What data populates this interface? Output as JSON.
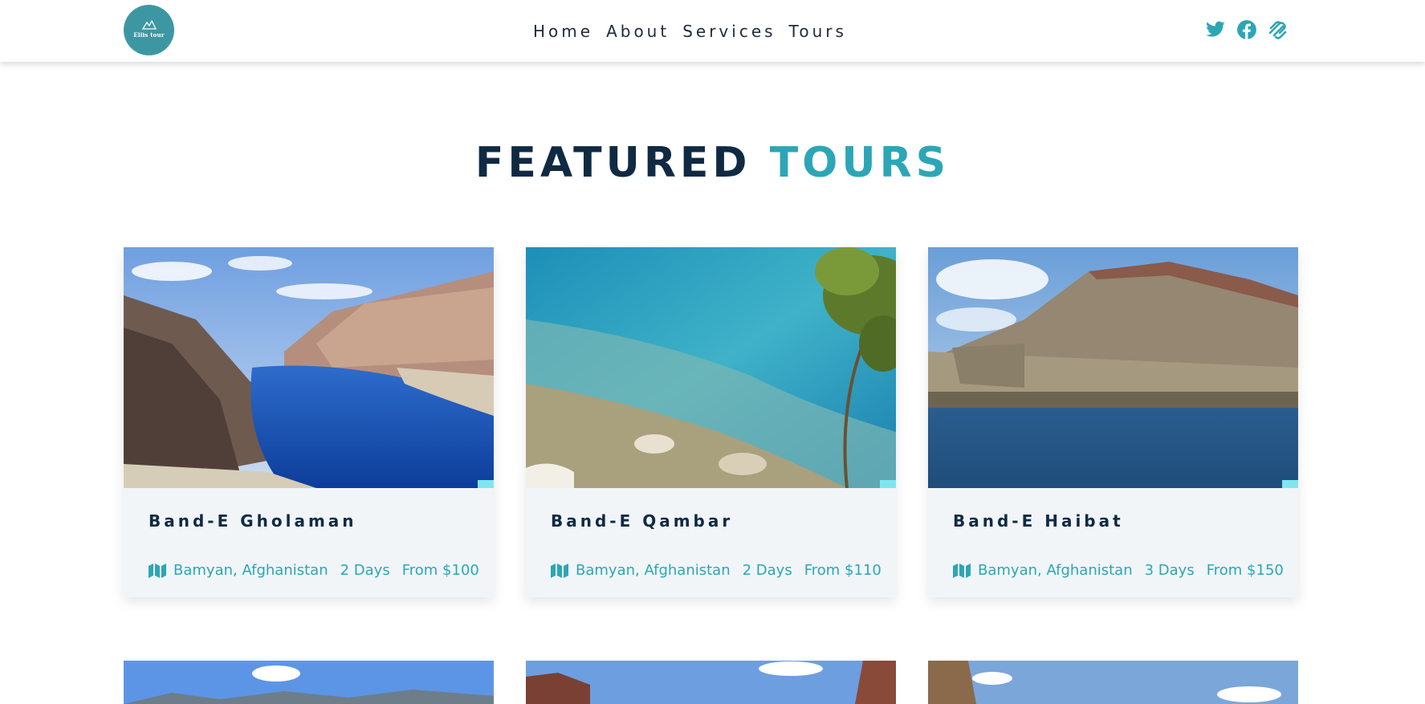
{
  "brand": {
    "logo_text": "Ellis tour",
    "accent": "#2ca6b6",
    "dark": "#102a43",
    "logo_bg": "#3d97a3"
  },
  "nav": {
    "links": [
      "Home",
      "About",
      "Services",
      "Tours"
    ]
  },
  "social": [
    "twitter-icon",
    "facebook-icon",
    "squarespace-icon"
  ],
  "section": {
    "title_part1": "FEATURED",
    "title_part2": "TOURS"
  },
  "tours": [
    {
      "name": "Band-E Gholaman",
      "location": "Bamyan, Afghanistan",
      "duration": "2 Days",
      "price": "From $100"
    },
    {
      "name": "Band-E Qambar",
      "location": "Bamyan, Afghanistan",
      "duration": "2 Days",
      "price": "From $110"
    },
    {
      "name": "Band-E Haibat",
      "location": "Bamyan, Afghanistan",
      "duration": "3 Days",
      "price": "From $150"
    }
  ]
}
